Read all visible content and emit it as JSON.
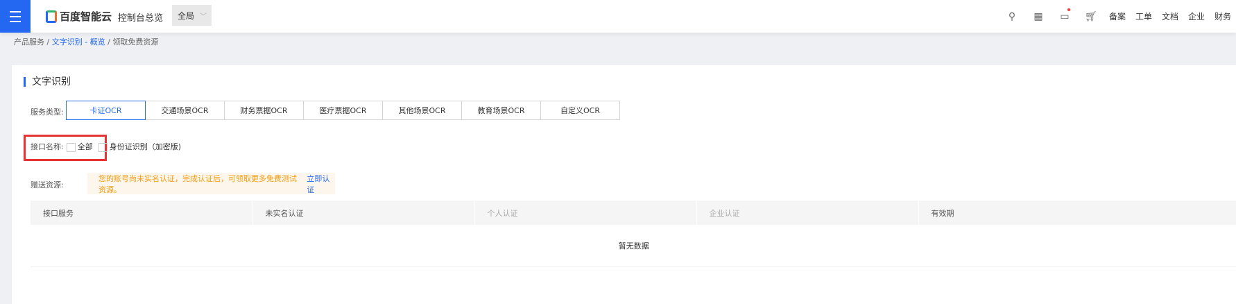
{
  "header": {
    "brand": "百度智能云",
    "console": "控制台总览",
    "scope": "全局",
    "nav": [
      "备案",
      "工单",
      "文档",
      "企业",
      "财务"
    ]
  },
  "breadcrumb": {
    "items": [
      "产品服务 /",
      "文字识别 - 概览",
      "/ 领取免费资源"
    ]
  },
  "section": {
    "title": "文字识别"
  },
  "service_type": {
    "label": "服务类型:",
    "tabs": [
      "卡证OCR",
      "交通场景OCR",
      "财务票据OCR",
      "医疗票据OCR",
      "其他场景OCR",
      "教育场景OCR",
      "自定义OCR"
    ]
  },
  "interface": {
    "label": "接口名称:",
    "all": "全部",
    "option": "身份证识别（加密版)"
  },
  "gift": {
    "label": "赠送资源:",
    "notice": "您的账号尚未实名认证，完成认证后，可领取更多免费测试资源。",
    "link": "立即认证"
  },
  "table": {
    "columns": [
      "接口服务",
      "未实名认证",
      "个人认证",
      "企业认证",
      "有效期"
    ],
    "empty": "暂无数据"
  },
  "colors": {
    "accent": "#2468f2",
    "highlight": "#e63434",
    "warning": "#f39c12"
  }
}
